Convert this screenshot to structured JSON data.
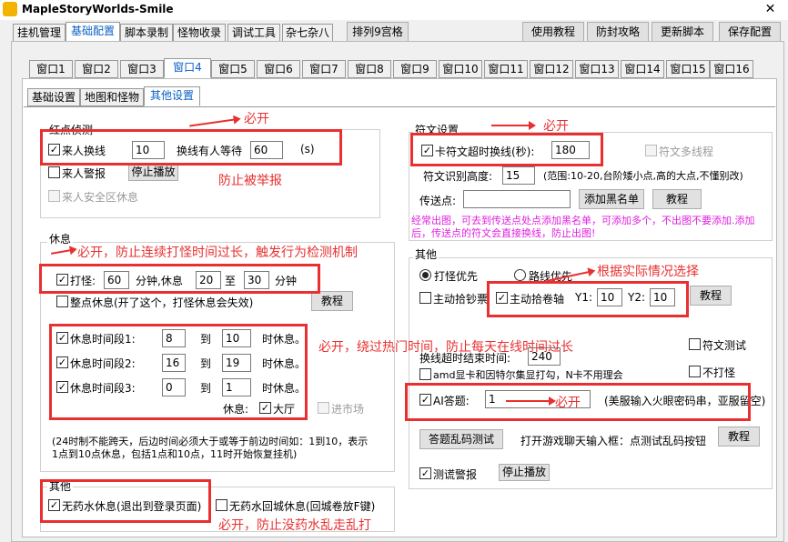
{
  "window": {
    "title": "MapleStoryWorlds-Smile",
    "close": "✕"
  },
  "main_tabs": [
    "挂机管理",
    "基础配置",
    "脚本录制",
    "怪物收录",
    "调试工具",
    "杂七杂八",
    "排列9宫格"
  ],
  "top_buttons": {
    "tutorial": "使用教程",
    "anti_ban": "防封攻略",
    "update": "更新脚本",
    "save": "保存配置"
  },
  "window_tabs": [
    "窗口1",
    "窗口2",
    "窗口3",
    "窗口4",
    "窗口5",
    "窗口6",
    "窗口7",
    "窗口8",
    "窗口9",
    "窗口10",
    "窗口11",
    "窗口12",
    "窗口13",
    "窗口14",
    "窗口15",
    "窗口16"
  ],
  "sub_tabs": [
    "基础设置",
    "地图和怪物",
    "其他设置"
  ],
  "red_dot": {
    "title": "红点侦测",
    "switch_label": "来人换线",
    "switch_value": "10",
    "wait_label": "换线有人等待",
    "wait_value": "60",
    "wait_unit": "(s)",
    "alarm_label": "来人警报",
    "stop_play": "停止播放",
    "safe_rest_label": "来人安全区休息"
  },
  "rest": {
    "title": "休息",
    "play_label": "打怪:",
    "play_value": "60",
    "minute_rest": "分钟,休息",
    "rest_from": "20",
    "to": "至",
    "rest_to": "30",
    "minute": "分钟",
    "whole_point": "整点休息(开了这个，打怪休息会失效)",
    "tutorial": "教程",
    "periods": [
      {
        "label": "休息时间段1:",
        "from": "8",
        "to_label": "到",
        "to": "10",
        "suffix": "时休息。"
      },
      {
        "label": "休息时间段2:",
        "from": "16",
        "to_label": "到",
        "to": "19",
        "suffix": "时休息。"
      },
      {
        "label": "休息时间段3:",
        "from": "0",
        "to_label": "到",
        "to": "1",
        "suffix": "时休息。"
      }
    ],
    "rest_at": "休息:",
    "hall": "大厅",
    "market": "进市场",
    "note": "(24时制不能跨天，后边时间必须大于或等于前边时间如：1到10，表示1点到10点休息，包括1点和10点，11时开始恢复挂机)"
  },
  "other_left": {
    "title": "其他",
    "no_potion_rest": "无药水休息(退出到登录页面)",
    "no_potion_town": "无药水回城休息(回城卷放F键)"
  },
  "rune": {
    "title": "符文设置",
    "timeout_label": "卡符文超时换线(秒):",
    "timeout_value": "180",
    "multi_thread": "符文多线程",
    "height_label": "符文识别高度:",
    "height_value": "15",
    "height_hint": "(范围:10-20,台阶矮小点,高的大点,不懂别改)",
    "teleport_label": "传送点:",
    "teleport_value": "",
    "add_blacklist": "添加黑名单",
    "tutorial": "教程",
    "pink_note": "经常出图，可去到传送点处点添加黑名单，可添加多个，不出图不要添加.添加后，传送点的符文会直接换线，防止出图!"
  },
  "other_right": {
    "title": "其他",
    "attack_first": "打怪优先",
    "route_first": "路线优先",
    "pick_money": "主动拾钞票",
    "pick_scroll": "主动拾卷轴",
    "y1_label": "Y1:",
    "y1_value": "10",
    "y2_label": "Y2:",
    "y2_value": "10",
    "tutorial": "教程",
    "rune_test": "符文测试",
    "switch_end_label": "换线超时结束时间:",
    "switch_end_value": "240",
    "amd_label": "amd显卡和因特尔集显打勾，N卡不用理会",
    "no_attack": "不打怪",
    "ai_answer": "AI答题:",
    "ai_value": "1",
    "ai_hint": "(美服输入火眼密码串，亚服留空)",
    "garble_test": "答题乱码测试",
    "garble_hint": "打开游戏聊天输入框：点测试乱码按钮",
    "tutorial2": "教程",
    "lie_alarm": "测谎警报",
    "stop_play": "停止播放"
  },
  "annotations": {
    "must_open": "必开",
    "prevent_report": "防止被举报",
    "rest_note": "必开，防止连续打怪时间过长，触发行为检测机制",
    "period_note": "必开，绕过热门时间，防止每天在线时间过长",
    "potion_note": "必开，防止没药水乱走乱打",
    "scroll_note": "根据实际情况选择"
  },
  "colors": {
    "annotation_red": "#e83030",
    "active_tab_blue": "#0b5fc4",
    "note_pink": "#e020e0"
  }
}
